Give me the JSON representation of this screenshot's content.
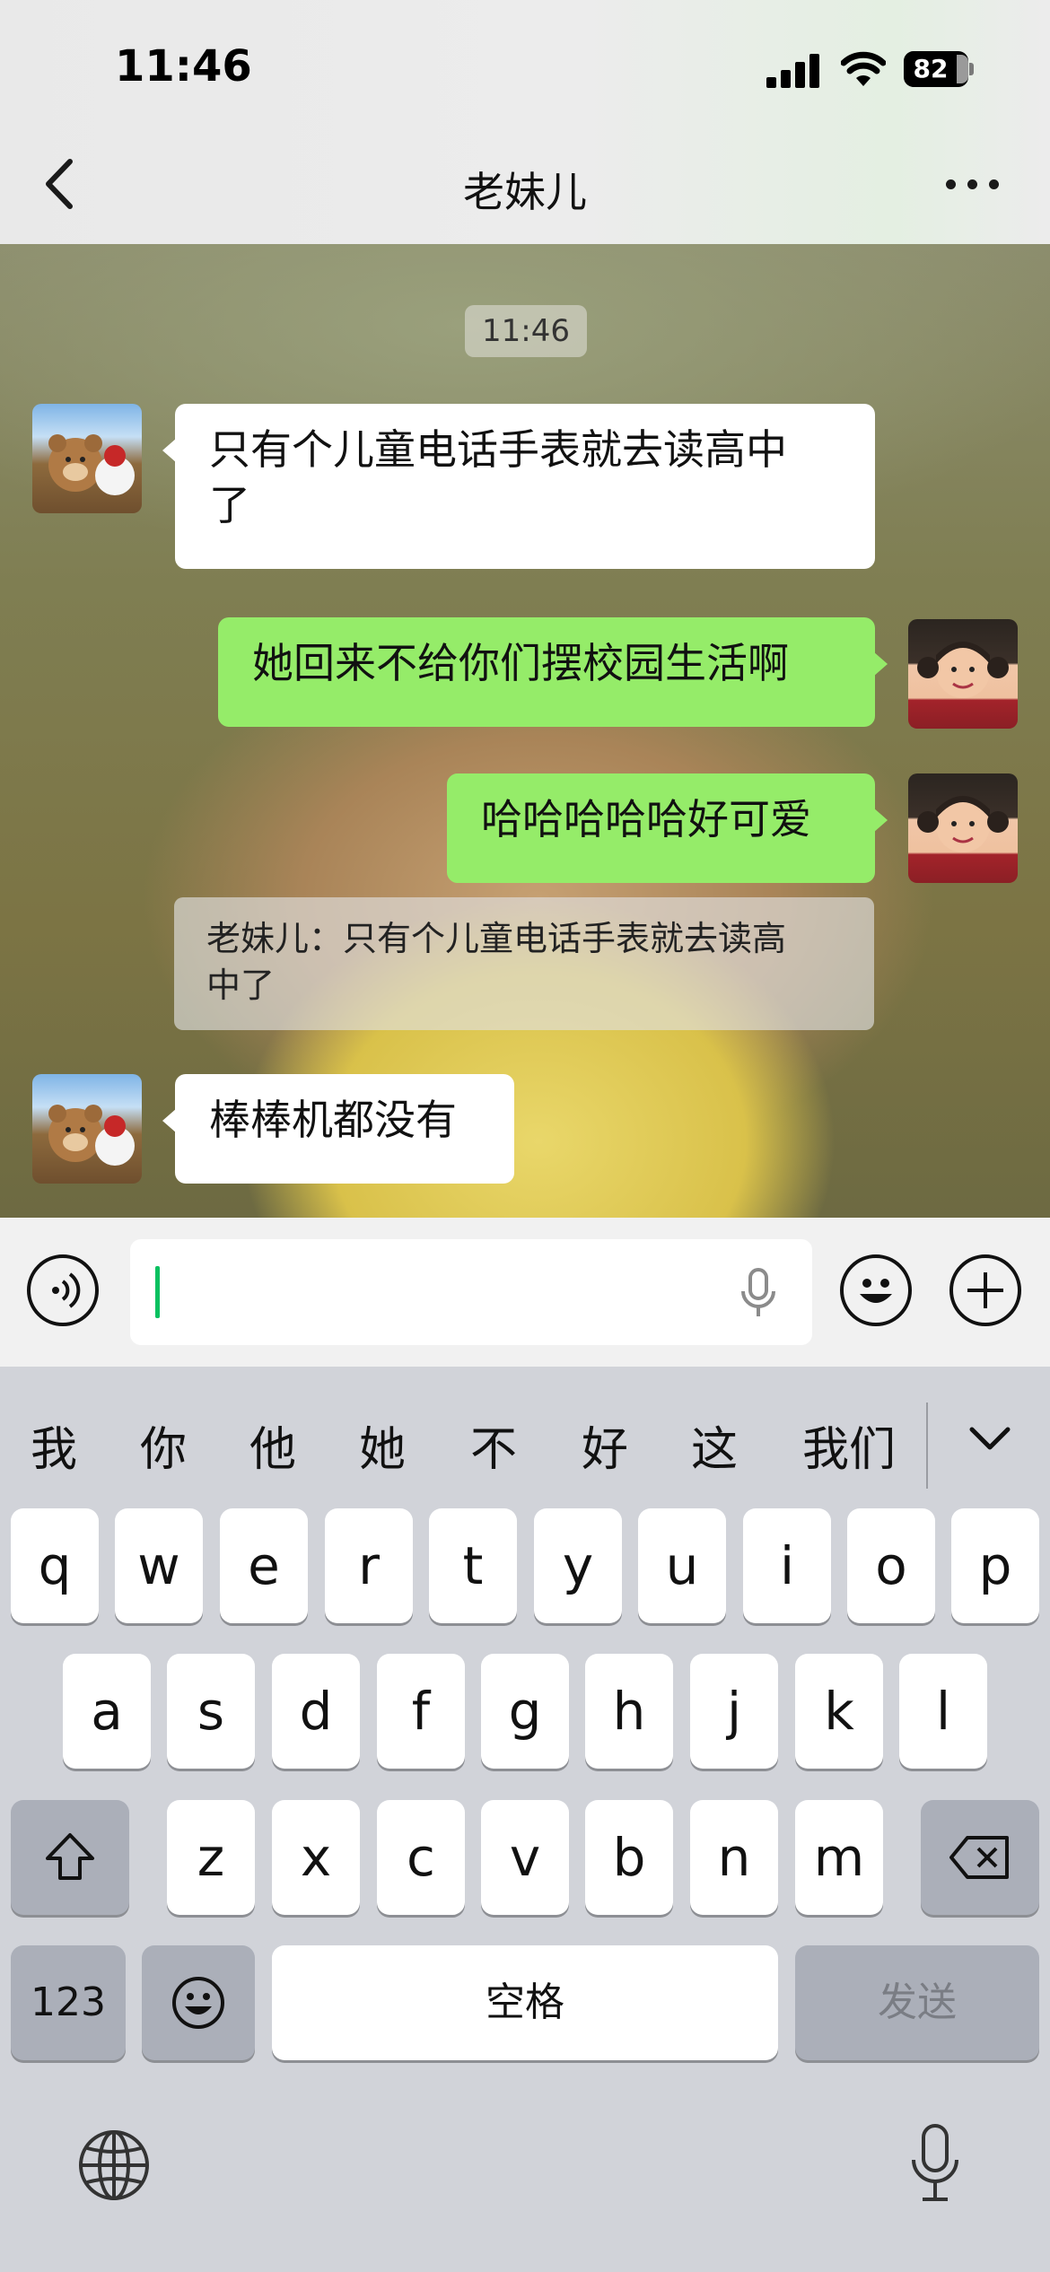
{
  "status_bar": {
    "time": "11:46",
    "battery": "82"
  },
  "nav": {
    "title": "老妹儿"
  },
  "chat": {
    "timestamp": "11:46",
    "messages": [
      {
        "side": "in",
        "text_line1": "只有个儿童电话手表就去读高中",
        "text_line2": "了"
      },
      {
        "side": "out",
        "text": "她回来不给你们摆校园生活啊"
      },
      {
        "side": "out",
        "text": "哈哈哈哈哈好可爱"
      },
      {
        "side": "in",
        "text": "棒棒机都没有"
      }
    ],
    "quote": {
      "line1": "老妹儿：只有个儿童电话手表就去读高",
      "line2": "中了"
    }
  },
  "input": {
    "value": ""
  },
  "keyboard": {
    "candidates": [
      "我",
      "你",
      "他",
      "她",
      "不",
      "好",
      "这",
      "我们"
    ],
    "row1": [
      "q",
      "w",
      "e",
      "r",
      "t",
      "y",
      "u",
      "i",
      "o",
      "p"
    ],
    "row2": [
      "a",
      "s",
      "d",
      "f",
      "g",
      "h",
      "j",
      "k",
      "l"
    ],
    "row3": [
      "z",
      "x",
      "c",
      "v",
      "b",
      "n",
      "m"
    ],
    "numbers_label": "123",
    "space_label": "空格",
    "send_label": "发送"
  },
  "colors": {
    "accent_green": "#95ec69",
    "caret_green": "#07c160",
    "incoming_bubble": "#ffffff"
  },
  "icons": [
    "back-icon",
    "more-icon",
    "voice-icon",
    "emoji-icon",
    "plus-icon",
    "mic-icon",
    "chevron-down-icon",
    "shift-icon",
    "delete-icon",
    "globe-icon"
  ]
}
